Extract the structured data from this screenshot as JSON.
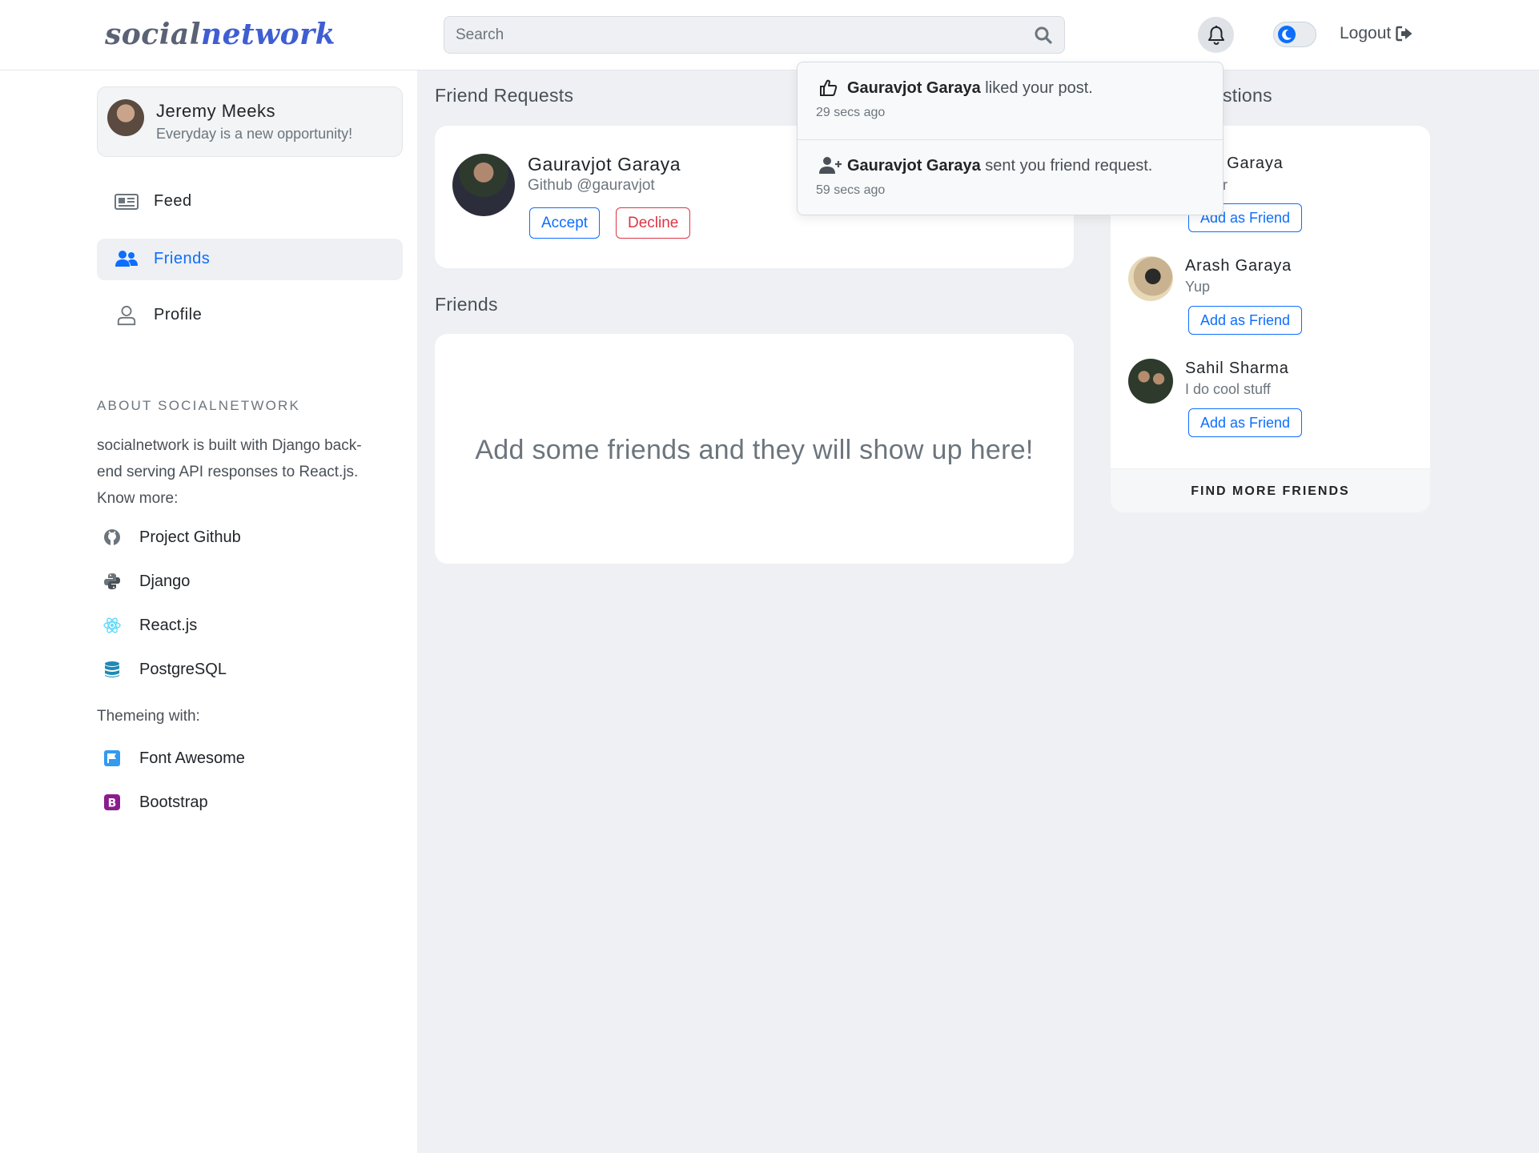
{
  "header": {
    "logo_part1": "social",
    "logo_part2": "network",
    "search_placeholder": "Search",
    "logout_label": "Logout"
  },
  "user": {
    "name": "Jeremy Meeks",
    "bio": "Everyday is a new opportunity!"
  },
  "nav": [
    {
      "label": "Feed",
      "icon": "newspaper-icon",
      "active": false
    },
    {
      "label": "Friends",
      "icon": "user-group-icon",
      "active": true
    },
    {
      "label": "Profile",
      "icon": "user-icon",
      "active": false
    }
  ],
  "about": {
    "title": "ABOUT SOCIALNETWORK",
    "text": "socialnetwork is built with Django back-end serving API responses to React.js. Know more:",
    "links": [
      {
        "label": "Project Github",
        "icon": "github-icon"
      },
      {
        "label": "Django",
        "icon": "python-icon"
      },
      {
        "label": "React.js",
        "icon": "react-icon"
      },
      {
        "label": "PostgreSQL",
        "icon": "database-icon"
      }
    ],
    "theme_title": "Themeing with:",
    "theme_links": [
      {
        "label": "Font Awesome",
        "icon": "font-awesome-flag-icon"
      },
      {
        "label": "Bootstrap",
        "icon": "bootstrap-icon"
      }
    ]
  },
  "friend_requests": {
    "title": "Friend Requests",
    "items": [
      {
        "name": "Gauravjot Garaya",
        "handle": "Github @gauravjot",
        "accept_label": "Accept",
        "decline_label": "Decline"
      }
    ]
  },
  "friends": {
    "title": "Friends",
    "empty_message": "Add some friends and they will show up here!"
  },
  "suggestions": {
    "title_visible": "stions",
    "items": [
      {
        "name_visible": "y Garaya",
        "bio_visible": "er",
        "button_label": "Add as Friend"
      },
      {
        "name": "Arash Garaya",
        "bio": "Yup",
        "button_label": "Add as Friend"
      },
      {
        "name": "Sahil Sharma",
        "bio": "I do cool stuff",
        "button_label": "Add as Friend"
      }
    ],
    "find_more_label": "FIND MORE FRIENDS"
  },
  "notifications": [
    {
      "actor": "Gauravjot Garaya",
      "text": " liked your post.",
      "time": "29 secs ago",
      "icon": "thumbs-up-icon"
    },
    {
      "actor": "Gauravjot Garaya",
      "text": " sent you friend request.",
      "time": "59 secs ago",
      "icon": "user-plus-icon"
    }
  ],
  "colors": {
    "primary": "#0d6efd",
    "danger": "#dc3545",
    "logo_dark": "#5b6275",
    "logo_blue": "#3f5ed3",
    "page_bg": "#eef0f3"
  }
}
